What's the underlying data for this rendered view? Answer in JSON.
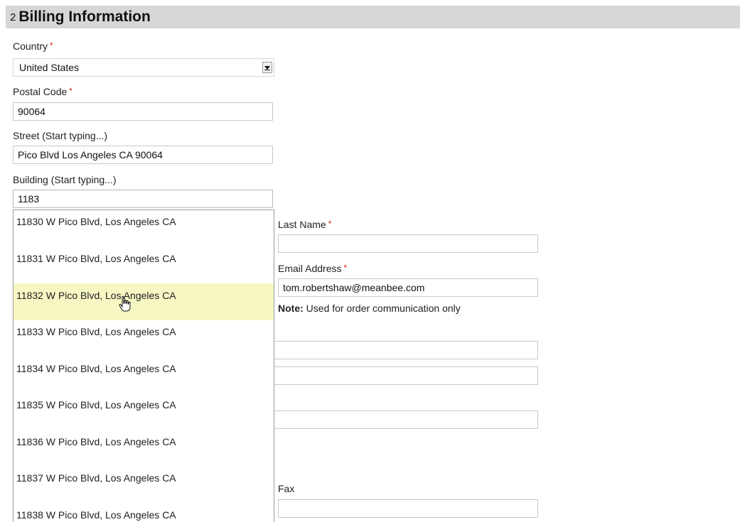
{
  "section": {
    "number": "2",
    "title": "Billing Information"
  },
  "form": {
    "country": {
      "label": "Country",
      "required_mark": "*",
      "value": "United States"
    },
    "postal_code": {
      "label": "Postal Code",
      "required_mark": "*",
      "value": "90064"
    },
    "street": {
      "label": "Street (Start typing...)",
      "value": "Pico Blvd Los Angeles CA 90064"
    },
    "building": {
      "label": "Building (Start typing...)",
      "value": "1183"
    },
    "last_name": {
      "label": "Last Name",
      "required_mark": "*",
      "value": ""
    },
    "email": {
      "label": "Email Address",
      "required_mark": "*",
      "value": "tom.robertshaw@meanbee.com"
    },
    "email_note": {
      "prefix": "Note:",
      "text": " Used for order communication only"
    },
    "fax": {
      "label": "Fax",
      "value": ""
    }
  },
  "suggestions": [
    "11830 W Pico Blvd, Los Angeles CA",
    "11831 W Pico Blvd, Los Angeles CA",
    "11832 W Pico Blvd, Los Angeles CA",
    "11833 W Pico Blvd, Los Angeles CA",
    "11834 W Pico Blvd, Los Angeles CA",
    "11835 W Pico Blvd, Los Angeles CA",
    "11836 W Pico Blvd, Los Angeles CA",
    "11837 W Pico Blvd, Los Angeles CA",
    "11838 W Pico Blvd, Los Angeles CA"
  ],
  "highlighted_suggestion_index": 2,
  "colors": {
    "header_bg": "#d7d7d7",
    "required": "#e02020",
    "highlight": "#f7f7c4"
  },
  "icons": {
    "select_arrow": "chevron-down-icon",
    "cursor": "hand-pointer-icon"
  }
}
